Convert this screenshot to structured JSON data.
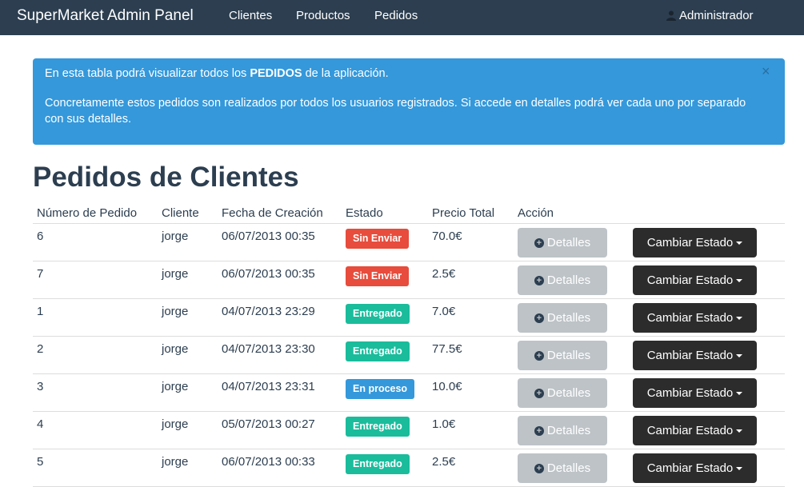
{
  "navbar": {
    "brand": "SuperMarket Admin Panel",
    "items": [
      {
        "label": "Clientes"
      },
      {
        "label": "Productos"
      },
      {
        "label": "Pedidos"
      }
    ],
    "user_label": "Administrador"
  },
  "alert": {
    "line1_pre": "En esta tabla podrá visualizar todos los ",
    "line1_bold": "PEDIDOS",
    "line1_post": " de la aplicación.",
    "line2": "Concretamente estos pedidos son realizados por todos los usuarios registrados. Si accede en detalles podrá ver cada uno por separado con sus detalles.",
    "close": "×"
  },
  "page_title": "Pedidos de Clientes",
  "table": {
    "headers": [
      "Número de Pedido",
      "Cliente",
      "Fecha de Creación",
      "Estado",
      "Precio Total",
      "Acción"
    ],
    "rows": [
      {
        "id": "6",
        "client": "jorge",
        "date": "06/07/2013 00:35",
        "status": "Sin Enviar",
        "status_color": "#e74c3c",
        "price": "70.0€"
      },
      {
        "id": "7",
        "client": "jorge",
        "date": "06/07/2013 00:35",
        "status": "Sin Enviar",
        "status_color": "#e74c3c",
        "price": "2.5€"
      },
      {
        "id": "1",
        "client": "jorge",
        "date": "04/07/2013 23:29",
        "status": "Entregado",
        "status_color": "#1abc9c",
        "price": "7.0€"
      },
      {
        "id": "2",
        "client": "jorge",
        "date": "04/07/2013 23:30",
        "status": "Entregado",
        "status_color": "#1abc9c",
        "price": "77.5€"
      },
      {
        "id": "3",
        "client": "jorge",
        "date": "04/07/2013 23:31",
        "status": "En proceso",
        "status_color": "#3498db",
        "price": "10.0€"
      },
      {
        "id": "4",
        "client": "jorge",
        "date": "05/07/2013 00:27",
        "status": "Entregado",
        "status_color": "#1abc9c",
        "price": "1.0€"
      },
      {
        "id": "5",
        "client": "jorge",
        "date": "06/07/2013 00:33",
        "status": "Entregado",
        "status_color": "#1abc9c",
        "price": "2.5€"
      }
    ],
    "details_label": "Detalles",
    "change_state_label": "Cambiar Estado"
  }
}
